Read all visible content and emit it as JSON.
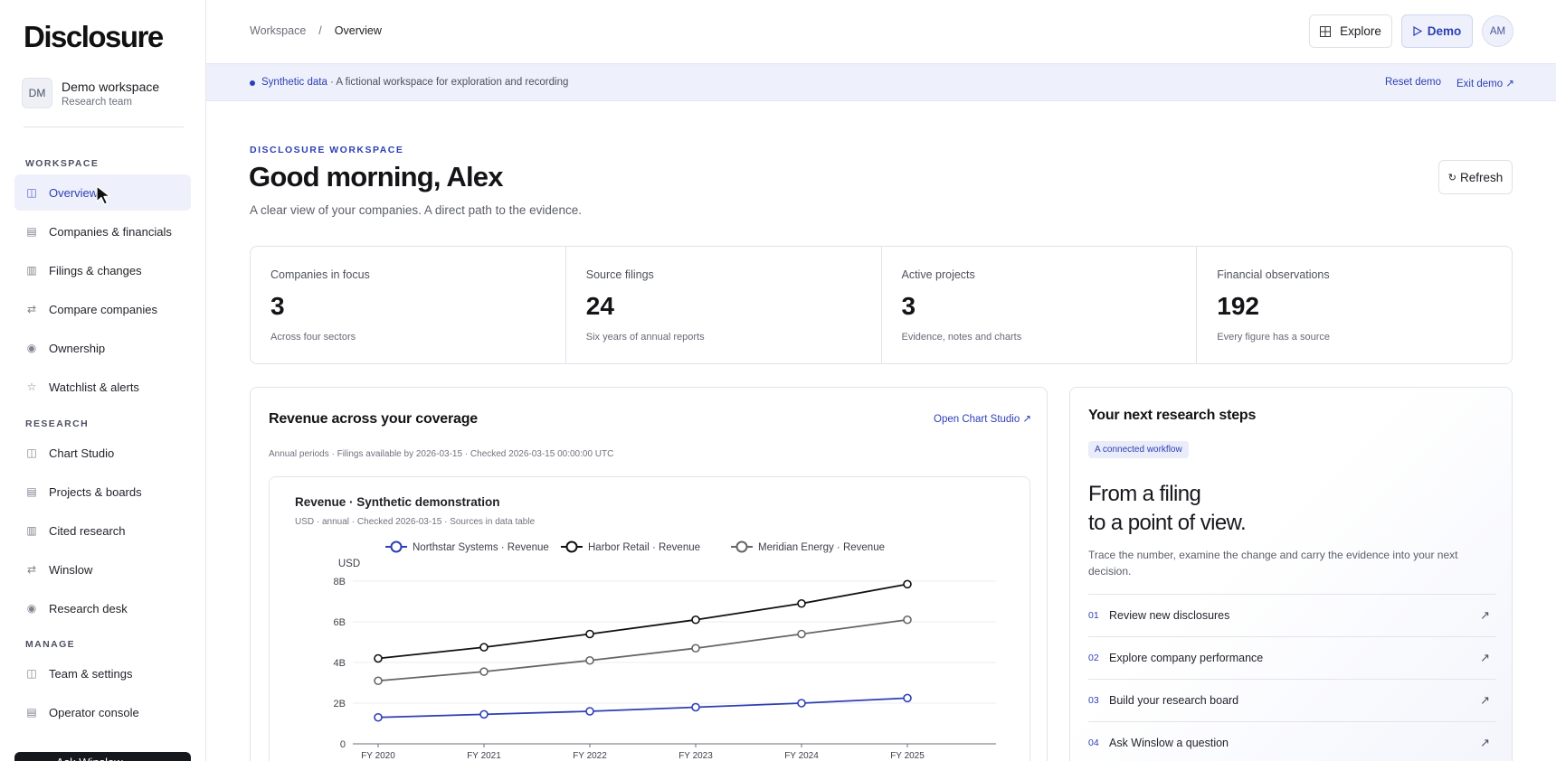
{
  "app": {
    "logo": "Disclosure",
    "workspace": {
      "initials": "DM",
      "name": "Demo workspace",
      "team": "Research team"
    }
  },
  "sidebar": {
    "sections": [
      {
        "title": "WORKSPACE",
        "items": [
          {
            "label": "Overview",
            "icon": "panel-icon",
            "active": true
          },
          {
            "label": "Companies & financials",
            "icon": "table-icon"
          },
          {
            "label": "Filings & changes",
            "icon": "columns-icon"
          },
          {
            "label": "Compare companies",
            "icon": "arrows-icon"
          },
          {
            "label": "Ownership",
            "icon": "circle-icon"
          },
          {
            "label": "Watchlist & alerts",
            "icon": "star-icon"
          }
        ]
      },
      {
        "title": "RESEARCH",
        "items": [
          {
            "label": "Chart Studio",
            "icon": "panel-icon"
          },
          {
            "label": "Projects & boards",
            "icon": "table-icon"
          },
          {
            "label": "Cited research",
            "icon": "columns-icon"
          },
          {
            "label": "Winslow",
            "icon": "arrows-icon"
          },
          {
            "label": "Research desk",
            "icon": "circle-icon"
          }
        ]
      },
      {
        "title": "MANAGE",
        "items": [
          {
            "label": "Team & settings",
            "icon": "panel-icon"
          },
          {
            "label": "Operator console",
            "icon": "table-icon"
          }
        ]
      }
    ],
    "ask_button": "Ask Winslow"
  },
  "topbar": {
    "breadcrumb": [
      "Workspace",
      "/",
      "Overview"
    ],
    "explore": "Explore",
    "demo": "Demo",
    "user_initials": "AM"
  },
  "banner": {
    "tag": "Synthetic data",
    "text": "· A fictional workspace for exploration and recording",
    "reset": "Reset demo",
    "exit": "Exit demo ↗"
  },
  "hero": {
    "eyebrow": "DISCLOSURE WORKSPACE",
    "greeting": "Good morning, Alex",
    "subline": "A clear view of your companies. A direct path to the evidence.",
    "refresh": "Refresh"
  },
  "stats": [
    {
      "label": "Companies in focus",
      "value": "3",
      "note": "Across four sectors"
    },
    {
      "label": "Source filings",
      "value": "24",
      "note": "Six years of annual reports"
    },
    {
      "label": "Active projects",
      "value": "3",
      "note": "Evidence, notes and charts"
    },
    {
      "label": "Financial observations",
      "value": "192",
      "note": "Every figure has a source"
    }
  ],
  "revenue": {
    "title": "Revenue across your coverage",
    "open_link": "Open Chart Studio ↗",
    "meta": "Annual periods · Filings available by 2026-03-15 · Checked 2026-03-15 00:00:00 UTC"
  },
  "chart_data": {
    "type": "line",
    "title": "Revenue · Synthetic demonstration",
    "subtitle": "USD · annual · Checked 2026-03-15 · Sources in data table",
    "ylabel": "USD",
    "x": [
      "FY 2020",
      "FY 2021",
      "FY 2022",
      "FY 2023",
      "FY 2024",
      "FY 2025"
    ],
    "ylim": [
      0,
      8
    ],
    "yticks": [
      0,
      2,
      4,
      6,
      8
    ],
    "ytick_labels": [
      "0",
      "2B",
      "4B",
      "6B",
      "8B"
    ],
    "grid": true,
    "legend_position": "top",
    "series": [
      {
        "name": "Northstar Systems · Revenue",
        "color": "#2d3fb4",
        "values": [
          1.3,
          1.45,
          1.6,
          1.8,
          2.0,
          2.25
        ]
      },
      {
        "name": "Harbor Retail · Revenue",
        "color": "#111111",
        "values": [
          4.2,
          4.75,
          5.4,
          6.1,
          6.9,
          7.85
        ]
      },
      {
        "name": "Meridian Energy · Revenue",
        "color": "#666666",
        "values": [
          3.1,
          3.55,
          4.1,
          4.7,
          5.4,
          6.1
        ]
      }
    ]
  },
  "steps": {
    "title": "Your next research steps",
    "chip": "A connected workflow",
    "headline_1": "From a filing",
    "headline_2": "to a point of view.",
    "description": "Trace the number, examine the change and carry the evidence into your next decision.",
    "items": [
      {
        "num": "01",
        "label": "Review new disclosures"
      },
      {
        "num": "02",
        "label": "Explore company performance"
      },
      {
        "num": "03",
        "label": "Build your research board"
      },
      {
        "num": "04",
        "label": "Ask Winslow a question"
      }
    ]
  }
}
